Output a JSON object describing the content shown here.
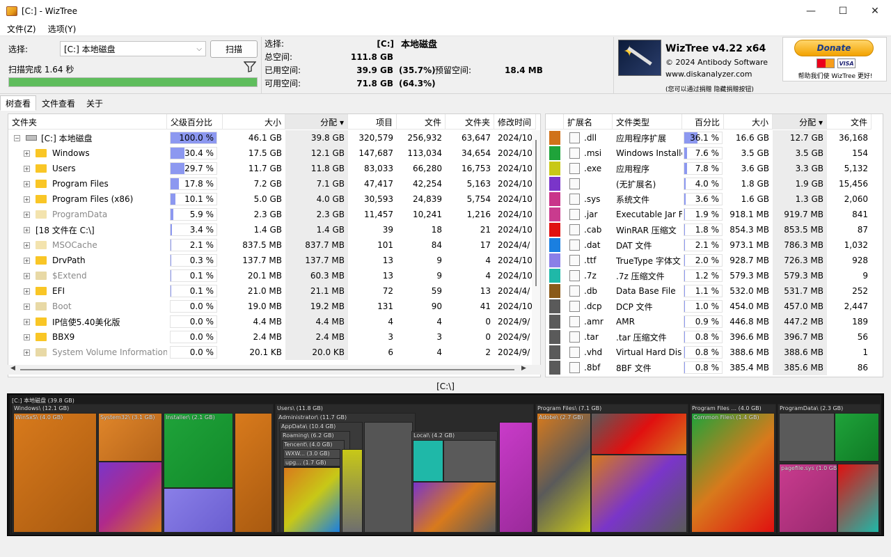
{
  "window": {
    "title": "[C:]  - WizTree",
    "min": "—",
    "max": "☐",
    "close": "✕"
  },
  "menu": [
    "文件(Z)",
    "选项(Y)"
  ],
  "toolbar": {
    "select_label": "选择:",
    "drive_value": "[C:] 本地磁盘",
    "scan_label": "扫描",
    "status": "扫描完成 1.64 秒",
    "progress": 1.0
  },
  "info": {
    "select_label": "选择:",
    "select_drive": "[C:]",
    "select_name": "本地磁盘",
    "total_label": "总空间:",
    "total_value": "111.8 GB",
    "used_label": "已用空间:",
    "used_value": "39.9 GB",
    "used_pct": "(35.7%)",
    "reserved_label": "预留空间:",
    "reserved_value": "18.4 MB",
    "free_label": "可用空间:",
    "free_value": "71.8 GB",
    "free_pct": "(64.3%)"
  },
  "brand": {
    "name": "WizTree v4.22 x64",
    "copyright": "© 2024 Antibody Software",
    "url": "www.diskanalyzer.com",
    "note": "(您可以通过捐赠 隐藏捐赠按钮)"
  },
  "donate": {
    "button": "Donate",
    "visa": "VISA",
    "help": "帮助我们使 WizTree 更好!"
  },
  "tabs": [
    "树查看",
    "文件查看",
    "关于"
  ],
  "tree": {
    "headers": [
      "文件夹",
      "父级百分比",
      "大小",
      "分配 ▾",
      "项目",
      "文件",
      "文件夹",
      "修改时间"
    ],
    "rows": [
      {
        "name": "[C:] 本地磁盘",
        "pct": "100.0 %",
        "pv": 1.0,
        "size": "46.1 GB",
        "alloc": "39.8 GB",
        "items": "320,579",
        "files": "256,932",
        "folders": "63,647",
        "mod": "2024/10",
        "kind": "drive"
      },
      {
        "name": "Windows",
        "pct": "30.4 %",
        "pv": 0.304,
        "size": "17.5 GB",
        "alloc": "12.1 GB",
        "items": "147,687",
        "files": "113,034",
        "folders": "34,654",
        "mod": "2024/10",
        "kind": "yel"
      },
      {
        "name": "Users",
        "pct": "29.7 %",
        "pv": 0.297,
        "size": "11.7 GB",
        "alloc": "11.8 GB",
        "items": "83,033",
        "files": "66,280",
        "folders": "16,753",
        "mod": "2024/10",
        "kind": "yel"
      },
      {
        "name": "Program Files",
        "pct": "17.8 %",
        "pv": 0.178,
        "size": "7.2 GB",
        "alloc": "7.1 GB",
        "items": "47,417",
        "files": "42,254",
        "folders": "5,163",
        "mod": "2024/10",
        "kind": "yel"
      },
      {
        "name": "Program Files (x86)",
        "pct": "10.1 %",
        "pv": 0.101,
        "size": "5.0 GB",
        "alloc": "4.0 GB",
        "items": "30,593",
        "files": "24,839",
        "folders": "5,754",
        "mod": "2024/10",
        "kind": "yel"
      },
      {
        "name": "ProgramData",
        "pct": "5.9 %",
        "pv": 0.059,
        "size": "2.3 GB",
        "alloc": "2.3 GB",
        "items": "11,457",
        "files": "10,241",
        "folders": "1,216",
        "mod": "2024/10",
        "kind": "pale"
      },
      {
        "name": "[18 文件在 C:\\]",
        "pct": "3.4 %",
        "pv": 0.034,
        "size": "1.4 GB",
        "alloc": "1.4 GB",
        "items": "39",
        "files": "18",
        "folders": "21",
        "mod": "2024/10",
        "kind": "none"
      },
      {
        "name": "MSOCache",
        "pct": "2.1 %",
        "pv": 0.021,
        "size": "837.5 MB",
        "alloc": "837.7 MB",
        "items": "101",
        "files": "84",
        "folders": "17",
        "mod": "2024/4/",
        "kind": "pale"
      },
      {
        "name": "DrvPath",
        "pct": "0.3 %",
        "pv": 0.003,
        "size": "137.7 MB",
        "alloc": "137.7 MB",
        "items": "13",
        "files": "9",
        "folders": "4",
        "mod": "2024/10",
        "kind": "yel"
      },
      {
        "name": "$Extend",
        "pct": "0.1 %",
        "pv": 0.001,
        "size": "20.1 MB",
        "alloc": "60.3 MB",
        "items": "13",
        "files": "9",
        "folders": "4",
        "mod": "2024/10",
        "kind": "gear"
      },
      {
        "name": "EFI",
        "pct": "0.1 %",
        "pv": 0.001,
        "size": "21.0 MB",
        "alloc": "21.1 MB",
        "items": "72",
        "files": "59",
        "folders": "13",
        "mod": "2024/4/",
        "kind": "yel"
      },
      {
        "name": "Boot",
        "pct": "0.0 %",
        "pv": 0.0,
        "size": "19.0 MB",
        "alloc": "19.2 MB",
        "items": "131",
        "files": "90",
        "folders": "41",
        "mod": "2024/10",
        "kind": "gear"
      },
      {
        "name": "IP信使5.40美化版",
        "pct": "0.0 %",
        "pv": 0.0,
        "size": "4.4 MB",
        "alloc": "4.4 MB",
        "items": "4",
        "files": "4",
        "folders": "0",
        "mod": "2024/9/",
        "kind": "yel"
      },
      {
        "name": "BBX9",
        "pct": "0.0 %",
        "pv": 0.0,
        "size": "2.4 MB",
        "alloc": "2.4 MB",
        "items": "3",
        "files": "3",
        "folders": "0",
        "mod": "2024/9/",
        "kind": "yel"
      },
      {
        "name": "System Volume Information",
        "pct": "0.0 %",
        "pv": 0.0,
        "size": "20.1 KB",
        "alloc": "20.0 KB",
        "items": "6",
        "files": "4",
        "folders": "2",
        "mod": "2024/9/",
        "kind": "gear"
      }
    ]
  },
  "ext": {
    "headers": [
      "扩展名",
      "文件类型",
      "百分比",
      "大小",
      "分配 ▾",
      "文件"
    ],
    "rows": [
      {
        "color": "#d0721a",
        "ext": ".dll",
        "type": "应用程序扩展",
        "pct": "36.1 %",
        "pv": 0.361,
        "size": "16.6 GB",
        "alloc": "12.7 GB",
        "files": "36,168"
      },
      {
        "color": "#1fa33a",
        "ext": ".msi",
        "type": "Windows Installe",
        "pct": "7.6 %",
        "pv": 0.076,
        "size": "3.5 GB",
        "alloc": "3.5 GB",
        "files": "154"
      },
      {
        "color": "#c8c817",
        "ext": ".exe",
        "type": "应用程序",
        "pct": "7.8 %",
        "pv": 0.078,
        "size": "3.6 GB",
        "alloc": "3.3 GB",
        "files": "5,132"
      },
      {
        "color": "#7a35c9",
        "ext": "",
        "type": "(无扩展名)",
        "pct": "4.0 %",
        "pv": 0.04,
        "size": "1.8 GB",
        "alloc": "1.9 GB",
        "files": "15,456"
      },
      {
        "color": "#c9358a",
        "ext": ".sys",
        "type": "系统文件",
        "pct": "3.6 %",
        "pv": 0.036,
        "size": "1.6 GB",
        "alloc": "1.3 GB",
        "files": "2,060"
      },
      {
        "color": "#c93b8e",
        "ext": ".jar",
        "type": "Executable Jar Fi",
        "pct": "1.9 %",
        "pv": 0.019,
        "size": "918.1 MB",
        "alloc": "919.7 MB",
        "files": "841"
      },
      {
        "color": "#e01010",
        "ext": ".cab",
        "type": "WinRAR 压缩文",
        "pct": "1.8 %",
        "pv": 0.018,
        "size": "854.3 MB",
        "alloc": "853.5 MB",
        "files": "87"
      },
      {
        "color": "#1a7fe0",
        "ext": ".dat",
        "type": "DAT 文件",
        "pct": "2.1 %",
        "pv": 0.021,
        "size": "973.1 MB",
        "alloc": "786.3 MB",
        "files": "1,032"
      },
      {
        "color": "#8a7fe8",
        "ext": ".ttf",
        "type": "TrueType 字体文",
        "pct": "2.0 %",
        "pv": 0.02,
        "size": "928.7 MB",
        "alloc": "726.3 MB",
        "files": "928"
      },
      {
        "color": "#1fb8a8",
        "ext": ".7z",
        "type": ".7z 压缩文件",
        "pct": "1.2 %",
        "pv": 0.012,
        "size": "579.3 MB",
        "alloc": "579.3 MB",
        "files": "9"
      },
      {
        "color": "#8a5a1a",
        "ext": ".db",
        "type": "Data Base File",
        "pct": "1.1 %",
        "pv": 0.011,
        "size": "532.0 MB",
        "alloc": "531.7 MB",
        "files": "252"
      },
      {
        "color": "#5a5a5a",
        "ext": ".dcp",
        "type": "DCP 文件",
        "pct": "1.0 %",
        "pv": 0.01,
        "size": "454.0 MB",
        "alloc": "457.0 MB",
        "files": "2,447"
      },
      {
        "color": "#5a5a5a",
        "ext": ".amr",
        "type": "AMR",
        "pct": "0.9 %",
        "pv": 0.009,
        "size": "446.8 MB",
        "alloc": "447.2 MB",
        "files": "189"
      },
      {
        "color": "#5a5a5a",
        "ext": ".tar",
        "type": ".tar 压缩文件",
        "pct": "0.8 %",
        "pv": 0.008,
        "size": "396.6 MB",
        "alloc": "396.7 MB",
        "files": "56"
      },
      {
        "color": "#5a5a5a",
        "ext": ".vhd",
        "type": "Virtual Hard Disk",
        "pct": "0.8 %",
        "pv": 0.008,
        "size": "388.6 MB",
        "alloc": "388.6 MB",
        "files": "1"
      },
      {
        "color": "#5a5a5a",
        "ext": ".8bf",
        "type": "8BF 文件",
        "pct": "0.8 %",
        "pv": 0.008,
        "size": "385.4 MB",
        "alloc": "385.6 MB",
        "files": "86"
      }
    ]
  },
  "treemap": {
    "path": "[C:\\]",
    "root_label": "[C:] 本地磁盘 (39.8 GB)",
    "labels": {
      "windows": "Windows\\ (12.1 GB)",
      "winsxs": "WinSxS\\ (4.0 GB)",
      "system32": "System32\\ (3.1 GB)",
      "installer": "Installer\\ (2.1 GB)",
      "users": "Users\\ (11.8 GB)",
      "administrator": "Administrator\\ (11.7 GB)",
      "appdata": "AppData\\ (10.4 GB)",
      "roaming": "Roaming\\ (6.2 GB)",
      "tencent": "Tencent\\ (4.0 GB)",
      "wxw": "WXW... (3.0 GB)",
      "upg": "upg... (1.7 GB)",
      "local": "Local\\ (4.2 GB)",
      "programfiles": "Program Files\\ (7.1 GB)",
      "adobe": "Adobe\\ (2.7 GB)",
      "pf86": "Program Files ... (4.0 GB)",
      "commonfiles": "Common Files\\ (1.4 GB)",
      "programdata": "ProgramData\\ (2.3 GB)",
      "pagefile": "pagefile.sys (1.0 GB)"
    }
  }
}
